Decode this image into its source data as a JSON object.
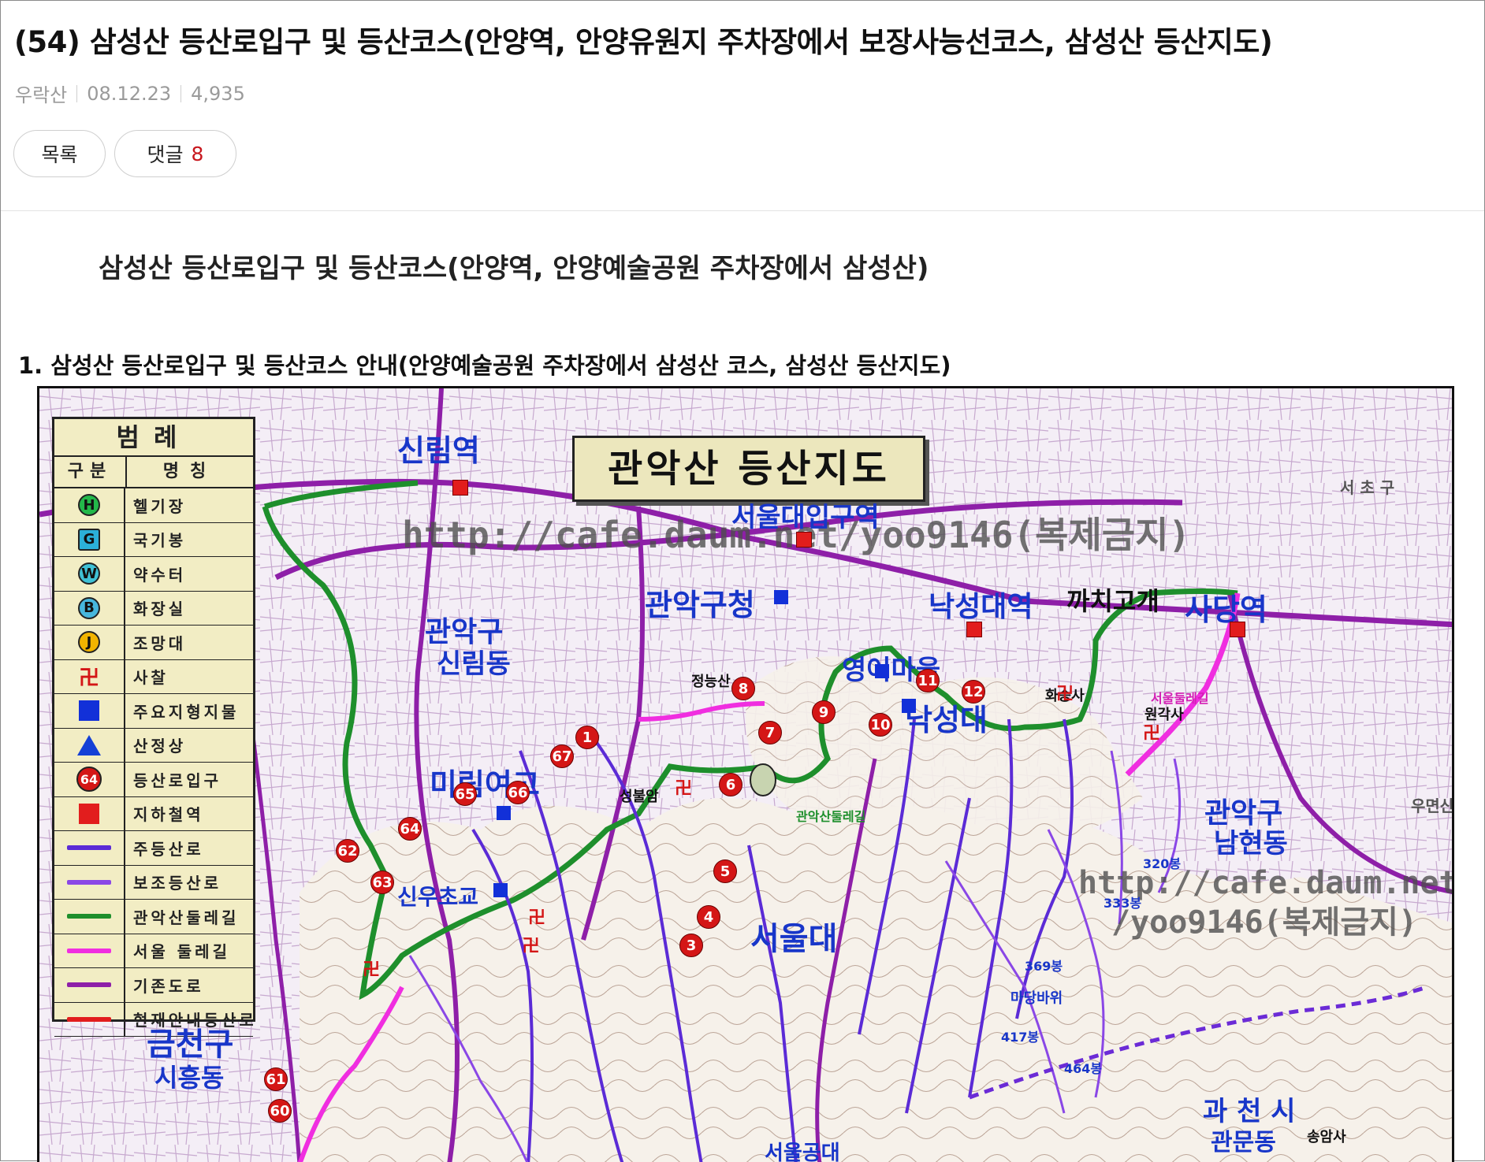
{
  "post": {
    "title": "(54) 삼성산 등산로입구 및 등산코스(안양역, 안양유원지 주차장에서 보장사능선코스, 삼성산 등산지도)",
    "author": "우락산",
    "date": "08.12.23",
    "views": "4,935",
    "list_button": "목록",
    "comment_button": "댓글",
    "comment_count": "8"
  },
  "content": {
    "heading": "삼성산 등산로입구 및 등산코스(안양역, 안양예술공원 주차장에서 삼성산)",
    "section1": "1. 삼성산 등산로입구 및 등산코스 안내(안양예술공원 주차장에서 삼성산 코스, 삼성산 등산지도)"
  },
  "map": {
    "title": "관악산  등산지도",
    "watermark_main": "http://cafe.daum.net/yoo9146(복제금지)",
    "watermark_line1": "http://cafe.daum.net",
    "watermark_line2": "/yoo9146(복제금지)",
    "legend": {
      "title": "범례",
      "col_type": "구분",
      "col_name": "명칭",
      "items": [
        {
          "symbol": "H",
          "name": "헬기장",
          "color": "#23b84a",
          "kind": "circle"
        },
        {
          "symbol": "G",
          "name": "국기봉",
          "color": "#2bb0d8",
          "kind": "square"
        },
        {
          "symbol": "W",
          "name": "약수터",
          "color": "#3fc1d6",
          "kind": "circle"
        },
        {
          "symbol": "B",
          "name": "화장실",
          "color": "#47b7dd",
          "kind": "circle"
        },
        {
          "symbol": "J",
          "name": "조망대",
          "color": "#f2b400",
          "kind": "circle"
        },
        {
          "symbol": "卍",
          "name": "사찰",
          "color": "#d41616",
          "kind": "text"
        },
        {
          "symbol": "",
          "name": "주요지형지물",
          "color": "#1230d8",
          "kind": "bluesquare"
        },
        {
          "symbol": "",
          "name": "산정상",
          "color": "#1440d6",
          "kind": "triangle"
        },
        {
          "symbol": "64",
          "name": "등산로입구",
          "color": "#d41616",
          "kind": "redcircle"
        },
        {
          "symbol": "",
          "name": "지하철역",
          "color": "#e21d1d",
          "kind": "redsquare"
        },
        {
          "symbol": "",
          "name": "주등산로",
          "color": "#5b2bd6",
          "kind": "line"
        },
        {
          "symbol": "",
          "name": "보조등산로",
          "color": "#8a47e6",
          "kind": "line"
        },
        {
          "symbol": "",
          "name": "관악산둘레길",
          "color": "#1e8f2c",
          "kind": "line"
        },
        {
          "symbol": "",
          "name": "서울 둘레길",
          "color": "#f02ee0",
          "kind": "line"
        },
        {
          "symbol": "",
          "name": "기존도로",
          "color": "#8e1fa8",
          "kind": "line"
        },
        {
          "symbol": "",
          "name": "현재안내등산로",
          "color": "#e21d1d",
          "kind": "line"
        }
      ]
    },
    "places": {
      "sillim_station": "신림역",
      "seoul_univ_station": "서울대입구역",
      "gwanak_office": "관악구청",
      "nakseongdae_station": "낙성대역",
      "kkachi": "까치고개",
      "sadang_station": "사당역",
      "gwanakgu_sillim_1": "관악구",
      "gwanakgu_sillim_2": "신림동",
      "mirim": "미림여고",
      "yeongeo": "영어마을",
      "nakseongdae": "낙성대",
      "jeongneungsan": "정능산",
      "seoul_univ": "서울대",
      "gwanakgu_namhyeon_1": "관악구",
      "gwanakgu_namhyeon_2": "남현동",
      "geumcheon_1": "금천구",
      "geumcheon_2": "시흥동",
      "gwacheon_1": "과 천 시",
      "gwacheon_2": "관문동",
      "sinwoo": "신우초교",
      "seoul_park": "서울공대",
      "seocho": "서 초 구",
      "umyeon": "우면산",
      "wongak": "원각사",
      "hwaseung": "화승사",
      "songam": "송암사",
      "seongbul": "성불암",
      "pt_320": "320봉",
      "pt_333": "333봉",
      "pt_369": "369봉",
      "pt_417": "417봉",
      "pt_464": "464봉",
      "madang": "마당바위",
      "gwanak_dulle": "관악산둘레길",
      "seoul_dulle": "서울둘레길"
    },
    "entrances": [
      "1",
      "3",
      "4",
      "5",
      "6",
      "7",
      "8",
      "9",
      "10",
      "11",
      "12",
      "60",
      "61",
      "62",
      "63",
      "64",
      "65",
      "66",
      "67"
    ]
  },
  "colors": {
    "accent_red": "#c8171e",
    "map_bg": "#f4eef6",
    "main_trail": "#5b2bd6",
    "road": "#8e1fa8",
    "gwanak_trail": "#1e8f2c",
    "seoul_trail": "#f02ee0"
  }
}
